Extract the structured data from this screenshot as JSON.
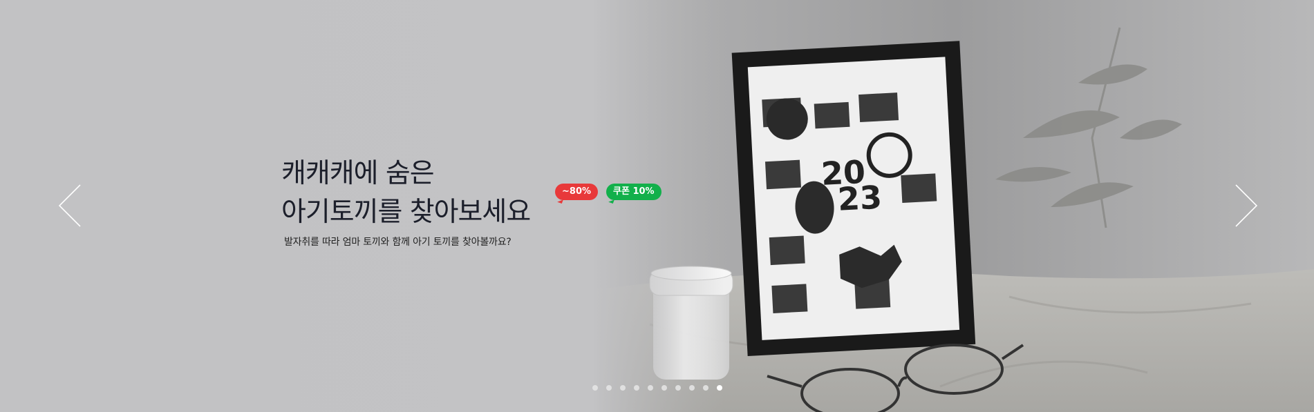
{
  "banner": {
    "title_line1": "캐캐캐에 숨은",
    "title_line2": "아기토끼를 찾아보세요",
    "badges": [
      {
        "label": "~80%",
        "color": "#e8393a"
      },
      {
        "label": "쿠폰 10%",
        "color": "#12b04b"
      }
    ],
    "subtitle": "발자취를 따라 엄마 토끼와 함께 아기 토끼를 찾아볼까요?",
    "calendar_year_top": "20",
    "calendar_year_bottom": "23",
    "prev_icon": "chevron-left-icon",
    "next_icon": "chevron-right-icon"
  },
  "pagination": {
    "total": 10,
    "active_index": 9
  }
}
